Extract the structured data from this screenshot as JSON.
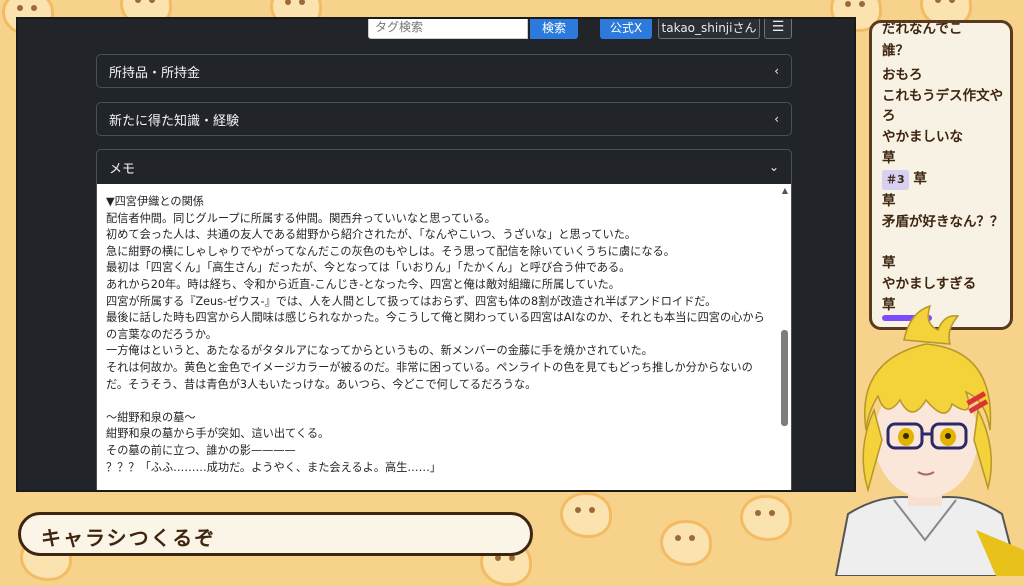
{
  "topbar": {
    "tag_search_placeholder": "タグ検索",
    "search_label": "検索",
    "official_x_label": "公式X",
    "user_label": "takao_shinjiさん",
    "menu_icon": "hamburger-icon"
  },
  "sections": [
    {
      "label": "所持品・所持金",
      "state": "collapsed"
    },
    {
      "label": "新たに得た知識・経験",
      "state": "collapsed"
    }
  ],
  "memo": {
    "label": "メモ",
    "state": "expanded",
    "lines": [
      "▼四宮伊織との関係",
      "配信者仲間。同じグループに所属する仲間。関西弁っていいなと思っている。",
      "初めて会った人は、共通の友人である紺野から紹介されたが、「なんやこいつ、うざいな」と思っていた。",
      "急に紺野の横にしゃしゃりでやがってなんだこの灰色のもやしは。そう思って配信を除いていくうちに虜になる。",
      "最初は「四宮くん」「高生さん」だったが、今となっては「いおりん」「たかくん」と呼び合う仲である。",
      "あれから20年。時は経ち、令和から近直-こんじき-となった今、四宮と俺は敵対組織に所属していた。",
      "四宮が所属する『Zeus-ゼウス-』では、人を人間として扱ってはおらず、四宮も体の8割が改造され半ばアンドロイドだ。",
      "最後に話した時も四宮から人間味は感じられなかった。今こうして俺と関わっている四宮はAIなのか、それとも本当に四宮の心からの言葉なのだろうか。",
      "一方俺はというと、あたなるがタタルアになってからというもの、新メンバーの金藤に手を焼かされていた。",
      "それは何故か。黄色と金色でイメージカラーが被るのだ。非常に困っている。ペンライトの色を見てもどっち推しか分からないのだ。そうそう、昔は青色が3人もいたっけな。あいつら、今どこで何してるだろうな。",
      "",
      "〜紺野和泉の墓〜",
      "紺野和泉の墓から手が突如、這い出てくる。",
      "その墓の前に立つ、誰かの影————",
      "？？？「ふふ………成功だ。ようやく、また会えるよ。高生……」"
    ]
  },
  "chat": {
    "messages": [
      "だれなんでこ",
      "誰？",
      "おもろ",
      "これもうデス作文やろ",
      "やかましいな",
      "草",
      "草",
      "矛盾が好きなん？？",
      "草",
      "やかましすぎる",
      "草"
    ],
    "tag_badge": "＃3",
    "tag_badge_text": "草"
  },
  "title_bar": {
    "text": "キャラシつくるぞ"
  },
  "colors": {
    "primary": "#2c7bdc",
    "background": "#f6d28a",
    "panel_dark": "#212529",
    "accent_brown": "#3d2510",
    "chat_bar": "#7c4dff"
  }
}
